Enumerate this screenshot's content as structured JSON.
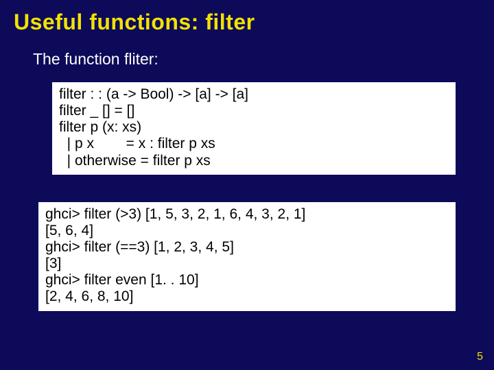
{
  "title": "Useful functions: filter",
  "subtitle": "The function fliter:",
  "defbox": {
    "l1": "filter : : (a -> Bool) -> [a] -> [a]",
    "l2": "filter _ [] = []",
    "l3": "filter p (x: xs)",
    "l4": "  | p x        = x : filter p xs",
    "l5": "  | otherwise = filter p xs"
  },
  "runbox": {
    "l1": "ghci> filter (>3) [1, 5, 3, 2, 1, 6, 4, 3, 2, 1]",
    "l2": "[5, 6, 4]",
    "l3": "ghci> filter (==3) [1, 2, 3, 4, 5]",
    "l4": "[3]",
    "l5": "ghci> filter even [1. . 10]",
    "l6": "[2, 4, 6, 8, 10]"
  },
  "pagenum": "5"
}
